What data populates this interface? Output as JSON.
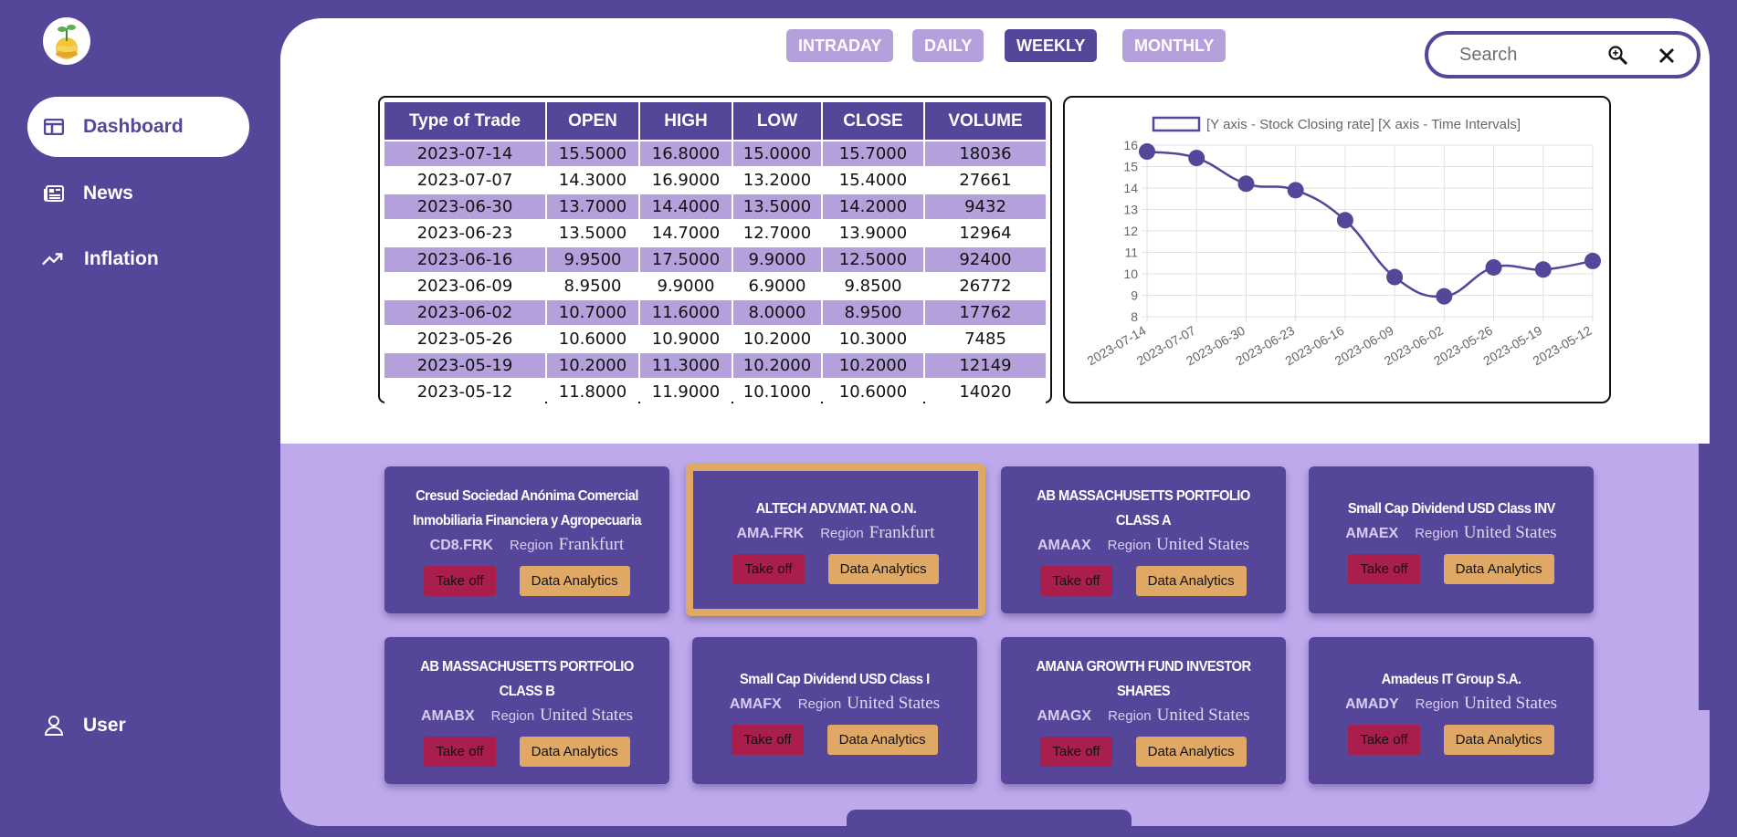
{
  "sidebar": {
    "items": [
      {
        "label": "Dashboard",
        "icon": "dashboard-icon"
      },
      {
        "label": "News",
        "icon": "newspaper-icon"
      },
      {
        "label": "Inflation",
        "icon": "trending-up-icon"
      }
    ],
    "user": {
      "label": "User",
      "icon": "user-icon"
    }
  },
  "tabs": [
    {
      "label": "INTRADAY"
    },
    {
      "label": "DAILY"
    },
    {
      "label": "WEEKLY"
    },
    {
      "label": "MONTHLY"
    }
  ],
  "search": {
    "placeholder": "Search"
  },
  "table": {
    "headers": [
      "Type of Trade",
      "OPEN",
      "HIGH",
      "LOW",
      "CLOSE",
      "VOLUME"
    ],
    "rows": [
      [
        "2023-07-14",
        "15.5000",
        "16.8000",
        "15.0000",
        "15.7000",
        "18036"
      ],
      [
        "2023-07-07",
        "14.3000",
        "16.9000",
        "13.2000",
        "15.4000",
        "27661"
      ],
      [
        "2023-06-30",
        "13.7000",
        "14.4000",
        "13.5000",
        "14.2000",
        "9432"
      ],
      [
        "2023-06-23",
        "13.5000",
        "14.7000",
        "12.7000",
        "13.9000",
        "12964"
      ],
      [
        "2023-06-16",
        "9.9500",
        "17.5000",
        "9.9000",
        "12.5000",
        "92400"
      ],
      [
        "2023-06-09",
        "8.9500",
        "9.9000",
        "6.9000",
        "9.8500",
        "26772"
      ],
      [
        "2023-06-02",
        "10.7000",
        "11.6000",
        "8.0000",
        "8.9500",
        "17762"
      ],
      [
        "2023-05-26",
        "10.6000",
        "10.9000",
        "10.2000",
        "10.3000",
        "7485"
      ],
      [
        "2023-05-19",
        "10.2000",
        "11.3000",
        "10.2000",
        "10.2000",
        "12149"
      ],
      [
        "2023-05-12",
        "11.8000",
        "11.9000",
        "10.1000",
        "10.6000",
        "14020"
      ]
    ]
  },
  "chart_data": {
    "type": "line",
    "legend": "[Y axis - Stock Closing rate]  [X axis - Time Intervals]",
    "categories": [
      "2023-07-14",
      "2023-07-07",
      "2023-06-30",
      "2023-06-23",
      "2023-06-16",
      "2023-06-09",
      "2023-06-02",
      "2023-05-26",
      "2023-05-19",
      "2023-05-12"
    ],
    "series": [
      {
        "values": [
          15.7,
          15.4,
          14.2,
          13.9,
          12.5,
          9.85,
          8.95,
          10.3,
          10.2,
          10.6
        ]
      }
    ],
    "ylim": [
      8,
      16
    ],
    "yticks": [
      8,
      9,
      10,
      11,
      12,
      13,
      14,
      15,
      16
    ],
    "grid": true,
    "legend_position": "top",
    "color": "#55469a"
  },
  "cards": [
    {
      "name": "Cresud Sociedad Anónima Comercial Inmobiliaria Financiera y Agropecuaria",
      "symbol": "CD8.FRK",
      "region_label": "Region",
      "region": "Frankfurt",
      "take_off": "Take off",
      "analytics": "Data Analytics"
    },
    {
      "name": "ALTECH ADV.MAT. NA O.N.",
      "symbol": "AMA.FRK",
      "region_label": "Region",
      "region": "Frankfurt",
      "take_off": "Take off",
      "analytics": "Data Analytics"
    },
    {
      "name": "AB MASSACHUSETTS PORTFOLIO CLASS A",
      "symbol": "AMAAX",
      "region_label": "Region",
      "region": "United States",
      "take_off": "Take off",
      "analytics": "Data Analytics"
    },
    {
      "name": "Small Cap Dividend USD Class INV",
      "symbol": "AMAEX",
      "region_label": "Region",
      "region": "United States",
      "take_off": "Take off",
      "analytics": "Data Analytics"
    },
    {
      "name": "AB MASSACHUSETTS PORTFOLIO CLASS B",
      "symbol": "AMABX",
      "region_label": "Region",
      "region": "United States",
      "take_off": "Take off",
      "analytics": "Data Analytics"
    },
    {
      "name": "Small Cap Dividend USD Class I",
      "symbol": "AMAFX",
      "region_label": "Region",
      "region": "United States",
      "take_off": "Take off",
      "analytics": "Data Analytics"
    },
    {
      "name": "AMANA GROWTH FUND INVESTOR SHARES",
      "symbol": "AMAGX",
      "region_label": "Region",
      "region": "United States",
      "take_off": "Take off",
      "analytics": "Data Analytics"
    },
    {
      "name": "Amadeus IT Group S.A.",
      "symbol": "AMADY",
      "region_label": "Region",
      "region": "United States",
      "take_off": "Take off",
      "analytics": "Data Analytics"
    }
  ],
  "colors": {
    "brand": "#55469a",
    "tab_inactive": "#b4a1dc",
    "take_off": "#a91e4c",
    "analytics": "#dfa865",
    "lower_bg": "#bda9ec"
  }
}
